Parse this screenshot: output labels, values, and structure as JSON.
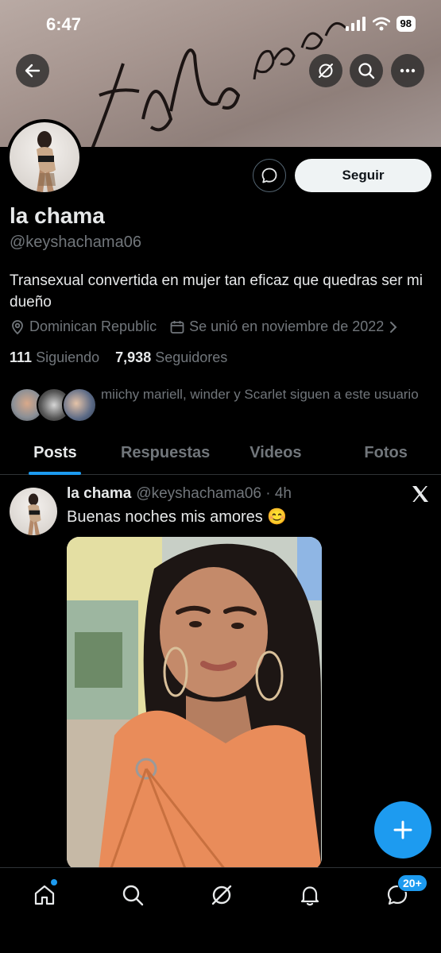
{
  "status_bar": {
    "time": "6:47",
    "battery": "98"
  },
  "banner": {
    "script_text": "do pasi"
  },
  "profile": {
    "name": "la chama",
    "handle": "@keyshachama06",
    "bio": "Transexual convertida en mujer tan eficaz que quedras ser mi dueño",
    "location": "Dominican Republic",
    "joined": "Se unió en noviembre de 2022",
    "following_count": "111",
    "following_label": "Siguiendo",
    "followers_count": "7,938",
    "followers_label": "Seguidores",
    "followers_you_know": "miichy mariell, winder y Scarlet siguen a este usuario"
  },
  "actions": {
    "follow_label": "Seguir"
  },
  "tabs": [
    {
      "label": "Posts",
      "active": true
    },
    {
      "label": "Respuestas",
      "active": false
    },
    {
      "label": "Videos",
      "active": false
    },
    {
      "label": "Fotos",
      "active": false
    }
  ],
  "post": {
    "name": "la chama",
    "handle_time": "@keyshachama06 · 4h",
    "text": "Buenas noches mis amores 😊"
  },
  "nav": {
    "messages_badge": "20+"
  },
  "colors": {
    "accent": "#1d9bf0",
    "background": "#000000",
    "secondary_text": "#71767b"
  },
  "icons": [
    "back-arrow-icon",
    "grok-icon",
    "search-icon",
    "more-icon",
    "message-icon",
    "location-icon",
    "calendar-icon",
    "chevron-right-icon",
    "x-logo-icon",
    "plus-icon",
    "home-icon",
    "notifications-icon",
    "messages-icon"
  ]
}
